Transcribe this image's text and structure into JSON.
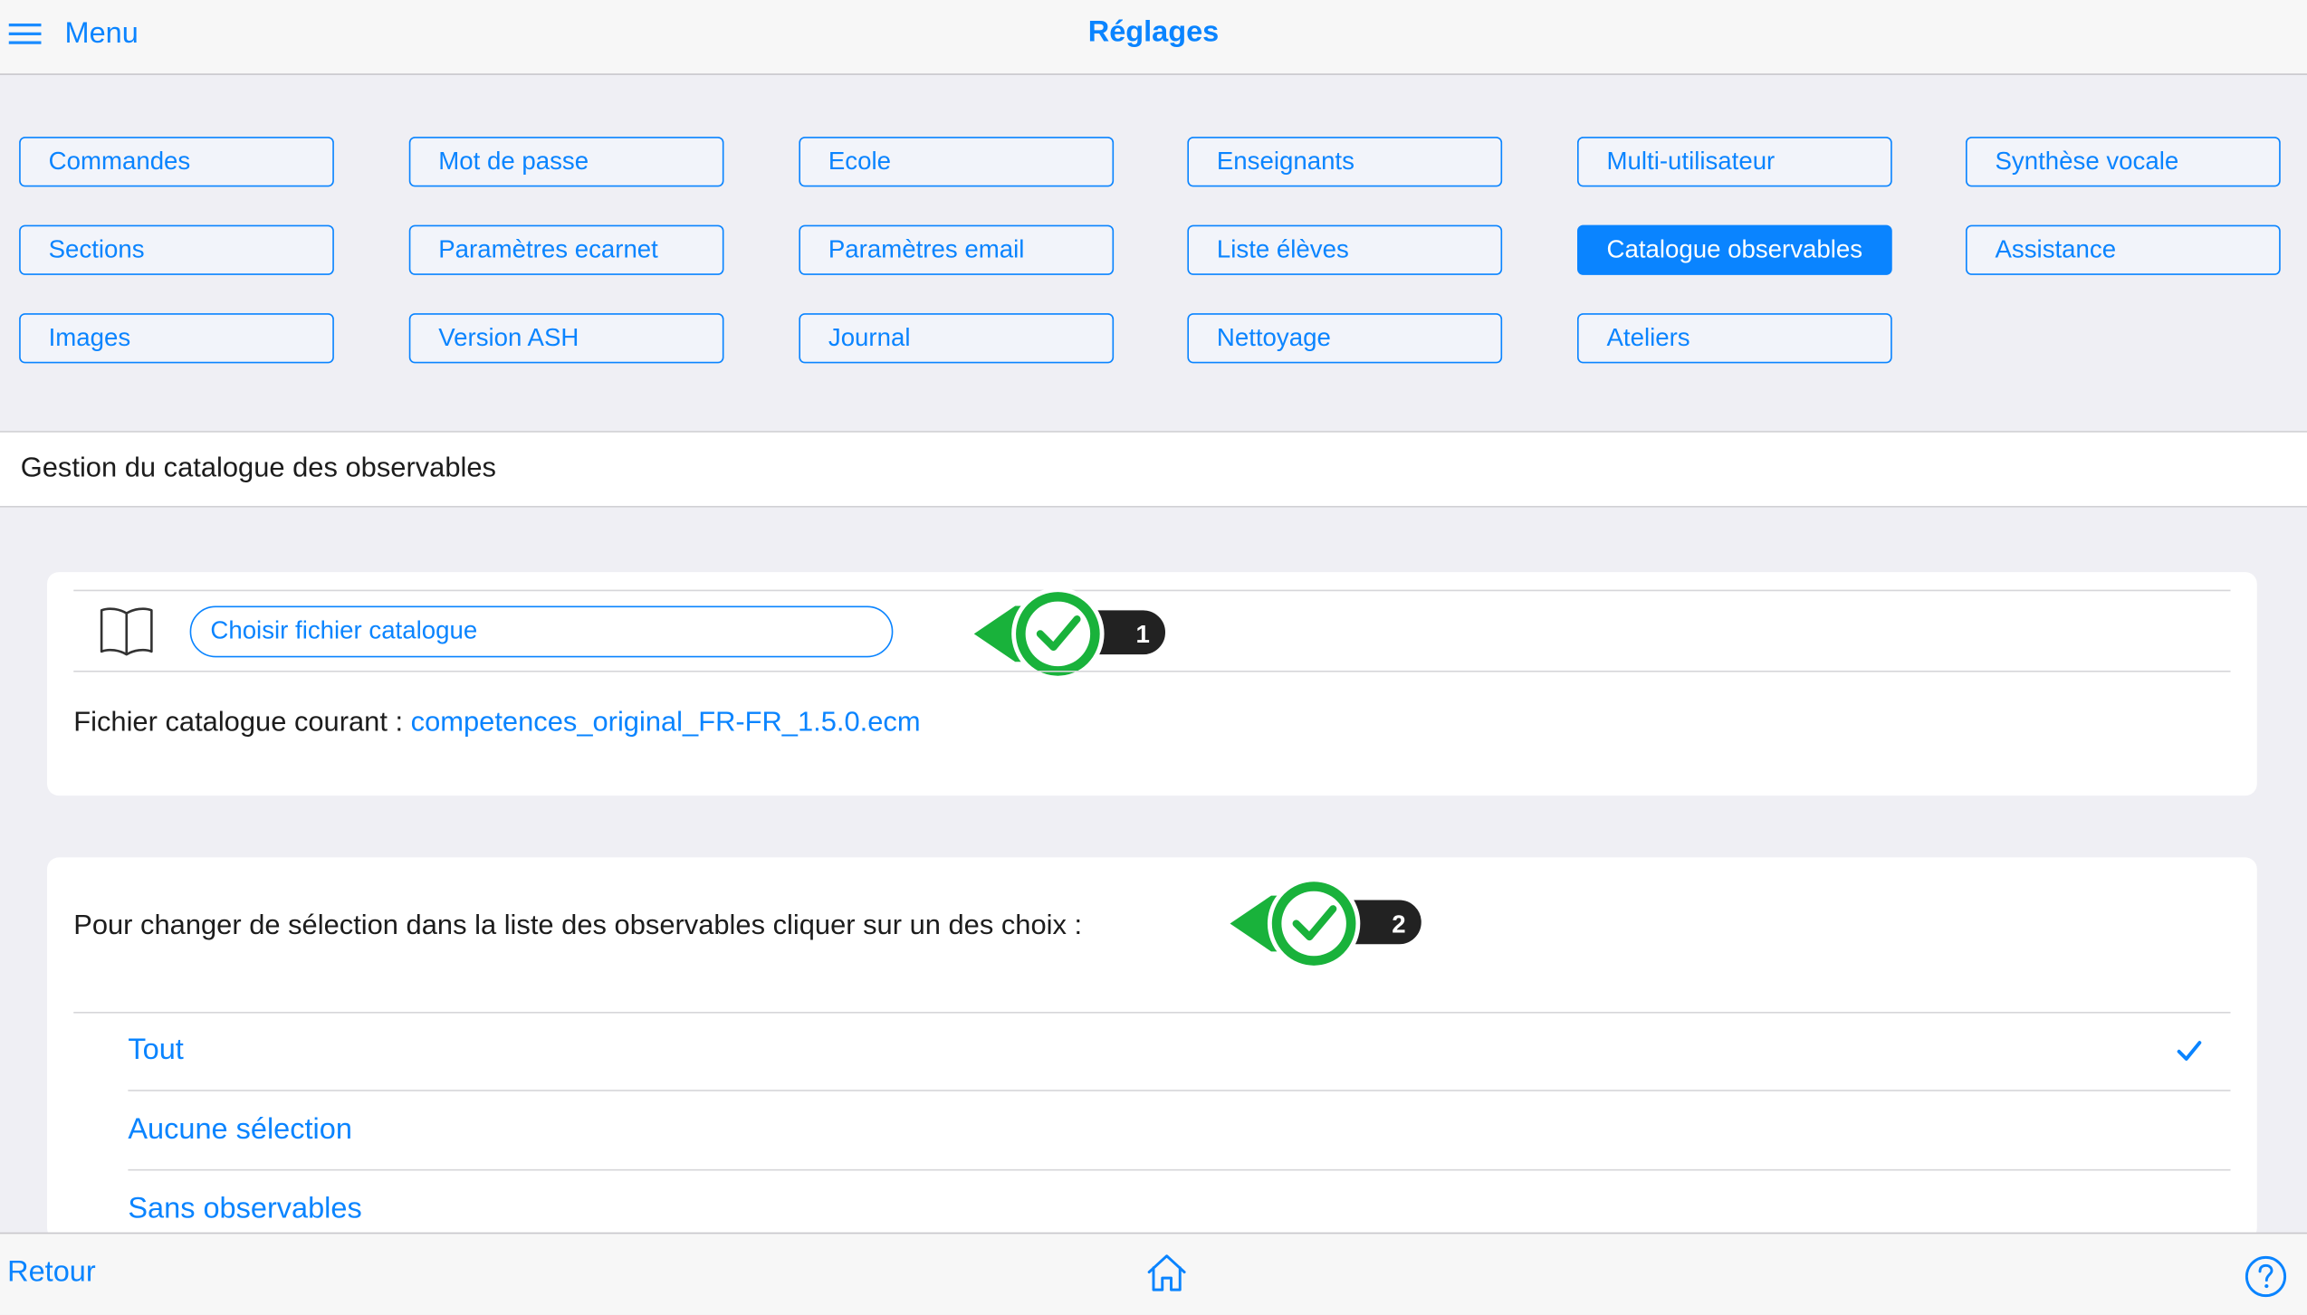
{
  "header": {
    "menu_label": "Menu",
    "title": "Réglages"
  },
  "settings_buttons": [
    [
      "Commandes",
      "Mot de passe",
      "Ecole",
      "Enseignants",
      "Multi-utilisateur",
      "Synthèse vocale"
    ],
    [
      "Sections",
      "Paramètres ecarnet",
      "Paramètres email",
      "Liste élèves",
      "Catalogue observables",
      "Assistance"
    ],
    [
      "Images",
      "Version ASH",
      "Journal",
      "Nettoyage",
      "Ateliers"
    ]
  ],
  "active_button": "Catalogue observables",
  "section": {
    "title": "Gestion du catalogue des observables"
  },
  "catalogue": {
    "choose_button": "Choisir fichier catalogue",
    "current_label": "Fichier catalogue courant : ",
    "current_file": "competences_original_FR-FR_1.5.0.ecm"
  },
  "selection": {
    "instruction": "Pour changer de sélection dans la liste des observables cliquer sur un des choix :",
    "options": [
      "Tout",
      "Aucune sélection",
      "Sans observables"
    ],
    "selected": "Tout"
  },
  "markers": [
    "1",
    "2"
  ],
  "colors": {
    "accent": "#0a84ff",
    "marker_green": "#19b23b",
    "marker_badge": "#222222"
  },
  "footer": {
    "back_label": "Retour"
  }
}
